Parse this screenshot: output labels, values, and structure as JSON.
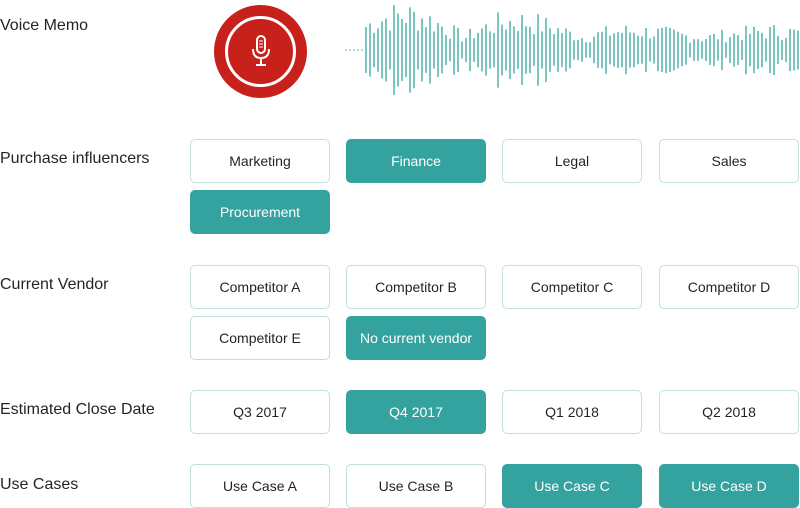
{
  "voice_memo": {
    "label": "Voice Memo",
    "record_icon": "microphone-icon",
    "record_color": "#c8201a",
    "waveform_color": "#5cb8b2"
  },
  "purchase_influencers": {
    "label": "Purchase influencers",
    "options": [
      {
        "label": "Marketing",
        "selected": false
      },
      {
        "label": "Finance",
        "selected": true
      },
      {
        "label": "Legal",
        "selected": false
      },
      {
        "label": "Sales",
        "selected": false
      },
      {
        "label": "Procurement",
        "selected": true
      }
    ]
  },
  "current_vendor": {
    "label": "Current Vendor",
    "options": [
      {
        "label": "Competitor A",
        "selected": false
      },
      {
        "label": "Competitor B",
        "selected": false
      },
      {
        "label": "Competitor C",
        "selected": false
      },
      {
        "label": "Competitor D",
        "selected": false
      },
      {
        "label": "Competitor E",
        "selected": false
      },
      {
        "label": "No current vendor",
        "selected": true
      }
    ]
  },
  "close_date": {
    "label": "Estimated Close Date",
    "options": [
      {
        "label": "Q3 2017",
        "selected": false
      },
      {
        "label": "Q4 2017",
        "selected": true
      },
      {
        "label": "Q1 2018",
        "selected": false
      },
      {
        "label": "Q2 2018",
        "selected": false
      }
    ]
  },
  "use_cases": {
    "label": "Use Cases",
    "options": [
      {
        "label": "Use Case A",
        "selected": false
      },
      {
        "label": "Use Case B",
        "selected": false
      },
      {
        "label": "Use Case C",
        "selected": true
      },
      {
        "label": "Use Case D",
        "selected": true
      }
    ]
  },
  "colors": {
    "accent": "#34a39f",
    "chip_border": "#bfe0dd"
  }
}
